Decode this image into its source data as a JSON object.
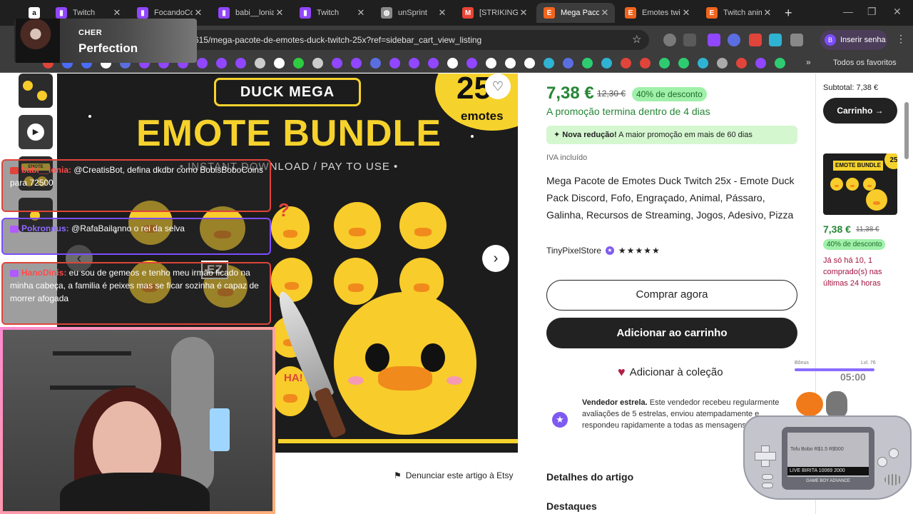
{
  "browser": {
    "tabs": [
      {
        "title": "",
        "icon": "amazon-icon",
        "color": "#ffffff",
        "active": false
      },
      {
        "title": "Twitch",
        "icon": "twitch-icon",
        "color": "#9146ff",
        "active": false
      },
      {
        "title": "FocandoCon",
        "icon": "twitch-icon",
        "color": "#9146ff",
        "active": false
      },
      {
        "title": "babi__lonia",
        "icon": "twitch-icon",
        "color": "#9146ff",
        "active": false
      },
      {
        "title": "Twitch",
        "icon": "twitch-icon",
        "color": "#9146ff",
        "active": false
      },
      {
        "title": "unSprint",
        "icon": "globe-icon",
        "color": "#8a8a8a",
        "active": false
      },
      {
        "title": "[STRIKINGLY]",
        "icon": "gmail-icon",
        "color": "#ea4335",
        "active": false
      },
      {
        "title": "Mega Pacote",
        "icon": "etsy-icon",
        "color": "#f1641e",
        "active": true
      },
      {
        "title": "Emotes twi",
        "icon": "etsy-icon",
        "color": "#f1641e",
        "active": false
      },
      {
        "title": "Twitch anim",
        "icon": "etsy-icon",
        "color": "#f1641e",
        "active": false
      }
    ],
    "new_tab": "+",
    "url": "615/mega-pacote-de-emotes-duck-twitch-25x?ref=sidebar_cart_view_listing",
    "signin": "Inserir senha",
    "signin_avatar": "B",
    "all_bookmarks": "Todos os favoritos",
    "ext_badge": "0"
  },
  "overlay": {
    "artist": "CHER",
    "song": "Perfection"
  },
  "hero": {
    "pill": "DUCK MEGA",
    "headline": "EMOTE BUNDLE",
    "tagline": "• INSTANT DOWNLOAD / PAY TO USE •",
    "badge_number": "25",
    "badge_label": "emotes",
    "sticker_ez": "EZ",
    "sticker_ha": "HA!",
    "question": "?"
  },
  "report": "Denunciar este artigo à Etsy",
  "product": {
    "price": "7,38 €",
    "price_old": "12,30 €",
    "discount": "40% de desconto",
    "promo_ends": "A promoção termina dentro de 4 dias",
    "reduction_bold": "Nova redução!",
    "reduction_text": " A maior promoção em mais de 60 dias",
    "vat": "IVA incluído",
    "title": "Mega Pacote de Emotes Duck Twitch 25x - Emote Duck Pack Discord, Fofo, Engraçado, Animal, Pássaro, Galinha, Recursos de Streaming, Jogos, Adesivo, Pizza",
    "seller": "TinyPixelStore",
    "rating": "★★★★★",
    "buy_now": "Comprar agora",
    "add_to_cart": "Adicionar ao carrinho",
    "add_to_collection": "Adicionar à coleção",
    "star_seller_bold": "Vendedor estrela.",
    "star_seller_text": " Este vendedor recebeu regularmente avaliações de 5 estrelas, enviou atempadamente e respondeu rapidamente a todas as mensagens recebidas.",
    "section_details": "Detalhes do artigo",
    "section_highlights": "Destaques"
  },
  "cart_panel": {
    "subtotal_label": "Subtotal:",
    "subtotal_value": "7,38 €",
    "cart_button": "Carrinho →",
    "thumb_title": "EMOTE BUNDLE",
    "thumb_badge": "25",
    "price": "7,38 €",
    "price_old": "11,38 €",
    "discount": "40% de desconto",
    "stock_note": "Já só há 10, 1 comprado(s) nas últimas 24 horas"
  },
  "chat": [
    {
      "user": "babi__lonia:",
      "message": " @CreatisBot, defina dkdbr como BobisBoboCoins para 72500"
    },
    {
      "user": "Pokronnus:",
      "message": " @RafaBailanno o rei da selva"
    },
    {
      "user": "HanoDinis:",
      "message": " eu sou de gemeos e tenho meu irmão ficado na minha cabeça, a familia é peixes mas se ficar sozinha é capaz de morrer afogada"
    }
  ],
  "game": {
    "bar_left": "Bônus",
    "bar_right": "Lvl. 76",
    "timer": "05:00",
    "lcd_line1": "Tofu Bobo    R$1.5    R$500",
    "lcd_line2": "LIVE BIRITA    10069    2000",
    "brand": "GAME BOY ADVANCE"
  }
}
